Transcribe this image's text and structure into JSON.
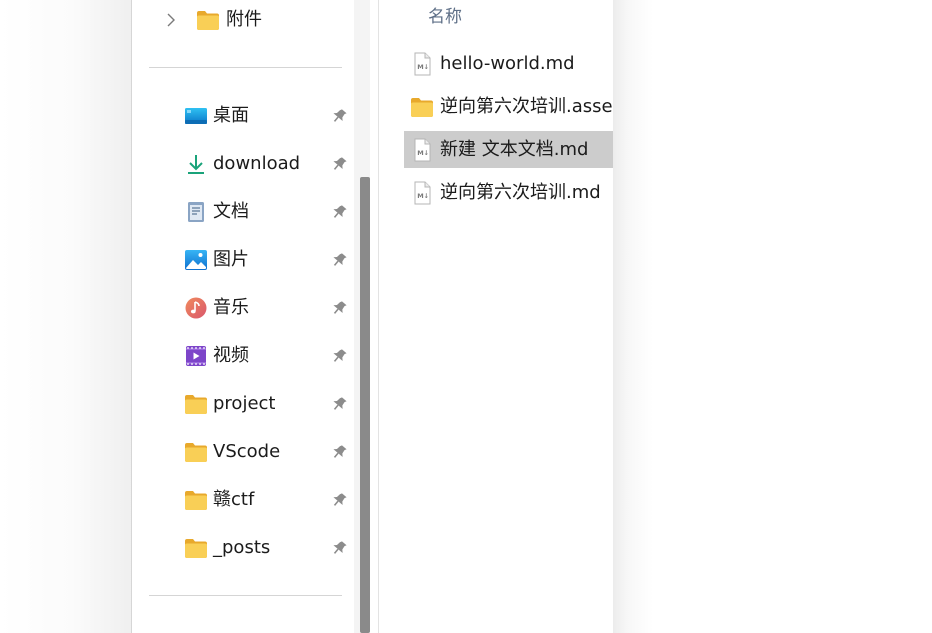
{
  "nav_pane": {
    "expandable": {
      "label": "附件",
      "icon": "folder-icon"
    },
    "quick_access": [
      {
        "label": "桌面",
        "icon": "desktop-icon",
        "pinned": true
      },
      {
        "label": "download",
        "icon": "download-icon",
        "pinned": true
      },
      {
        "label": "文档",
        "icon": "documents-icon",
        "pinned": true
      },
      {
        "label": "图片",
        "icon": "pictures-icon",
        "pinned": true
      },
      {
        "label": "音乐",
        "icon": "music-icon",
        "pinned": true
      },
      {
        "label": "视频",
        "icon": "videos-icon",
        "pinned": true
      },
      {
        "label": "project",
        "icon": "folder-icon",
        "pinned": true
      },
      {
        "label": "VScode",
        "icon": "folder-icon",
        "pinned": true
      },
      {
        "label": "赣ctf",
        "icon": "folder-icon",
        "pinned": true
      },
      {
        "label": "_posts",
        "icon": "folder-icon",
        "pinned": true
      }
    ]
  },
  "content": {
    "column_header": "名称",
    "files": [
      {
        "name": "hello-world.md",
        "icon": "markdown-file-icon",
        "selected": false
      },
      {
        "name": "逆向第六次培训.assets",
        "icon": "folder-icon",
        "selected": false
      },
      {
        "name": "新建 文本文档.md",
        "icon": "markdown-file-icon",
        "selected": true
      },
      {
        "name": "逆向第六次培训.md",
        "icon": "markdown-file-icon",
        "selected": false
      }
    ]
  },
  "colors": {
    "selection": "#cccccc",
    "header_text": "#5e6f87",
    "folder_yellow": "#f7c948",
    "scroll_thumb": "#8a8a8a"
  }
}
